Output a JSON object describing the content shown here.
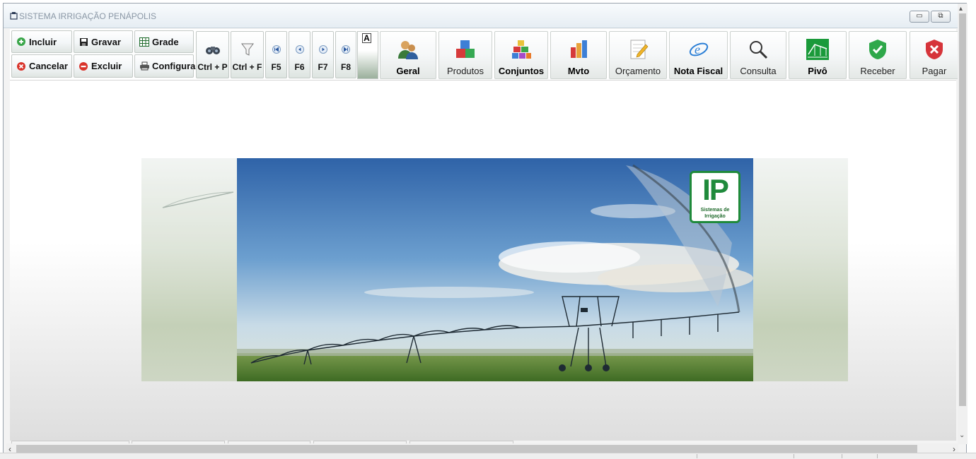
{
  "window": {
    "title": "SISTEMA IRRIGAÇÃO PENÁPOLIS"
  },
  "toolbar": {
    "small_buttons": {
      "incluir": "Incluir",
      "gravar": "Gravar",
      "grade": "Grade",
      "cancelar": "Cancelar",
      "excluir": "Excluir",
      "configura": "Configura"
    },
    "vertical_buttons": {
      "ctrl_p": "Ctrl + P",
      "ctrl_f": "Ctrl + F",
      "f5": "F5",
      "f6": "F6",
      "f7": "F7",
      "f8": "F8"
    },
    "font_toggle": "A",
    "modules": {
      "geral": "Geral",
      "produtos": "Produtos",
      "conjuntos": "Conjuntos",
      "mvto": "Mvto",
      "orcamento": "Orçamento",
      "nota_fiscal": "Nota Fiscal",
      "consulta": "Consulta",
      "pivo": "Pivô",
      "receber": "Receber",
      "pagar": "Pagar"
    }
  },
  "banner": {
    "logo_text": "IP",
    "logo_subtext": "Sistemas de Irrigação"
  },
  "colors": {
    "brand_green": "#1f8a3b",
    "title_text": "#8a97a5",
    "toolbar_bg": "#ffffff"
  }
}
